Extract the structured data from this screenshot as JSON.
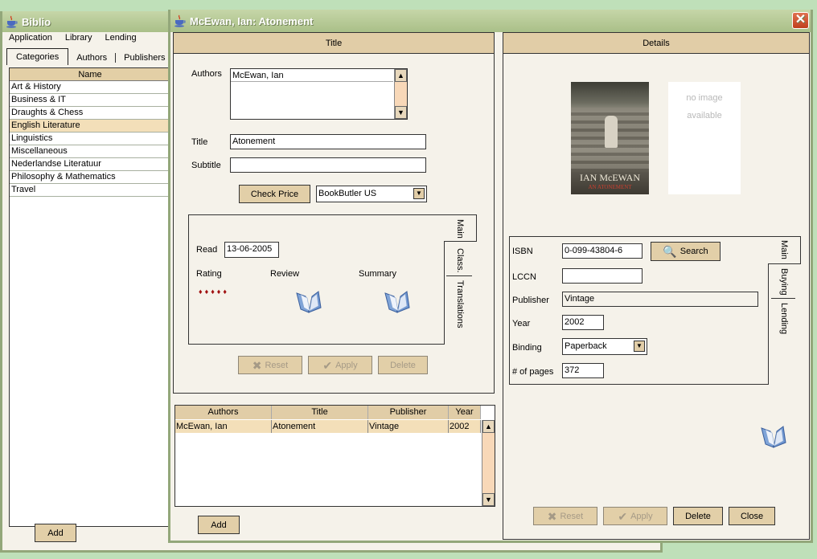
{
  "main_window": {
    "title": "Biblio",
    "menu": [
      "Application",
      "Library",
      "Lending"
    ],
    "tabs": [
      {
        "label": "Categories",
        "active": true
      },
      {
        "label": "Authors",
        "active": false
      },
      {
        "label": "Publishers",
        "active": false
      }
    ],
    "category_list": {
      "header": "Name",
      "items": [
        {
          "label": "Art & History",
          "selected": false
        },
        {
          "label": "Business & IT",
          "selected": false
        },
        {
          "label": "Draughts & Chess",
          "selected": false
        },
        {
          "label": "English Literature",
          "selected": true
        },
        {
          "label": "Linguistics",
          "selected": false
        },
        {
          "label": "Miscellaneous",
          "selected": false
        },
        {
          "label": "Nederlandse Literatuur",
          "selected": false
        },
        {
          "label": "Philosophy & Mathematics",
          "selected": false
        },
        {
          "label": "Travel",
          "selected": false
        }
      ]
    },
    "add_label": "Add"
  },
  "dialog": {
    "title": "McEwan, Ian: Atonement",
    "close_icon": "close-x",
    "title_section": {
      "header": "Title",
      "authors_label": "Authors",
      "authors_values": [
        "McEwan, Ian"
      ],
      "title_label": "Title",
      "title_value": "Atonement",
      "subtitle_label": "Subtitle",
      "subtitle_value": "",
      "check_price_label": "Check Price",
      "price_source": "BookButler US",
      "side_tabs": [
        "Main",
        "Class.",
        "Translations"
      ],
      "read_label": "Read",
      "read_value": "13-06-2005",
      "rating_label": "Rating",
      "rating_value": 5,
      "rating_max": 5,
      "review_label": "Review",
      "summary_label": "Summary",
      "reset_label": "Reset",
      "apply_label": "Apply",
      "delete_label": "Delete"
    },
    "books_table": {
      "columns": [
        "Authors",
        "Title",
        "Publisher",
        "Year"
      ],
      "rows": [
        {
          "authors": "McEwan, Ian",
          "title": "Atonement",
          "publisher": "Vintage",
          "year": "2002"
        }
      ],
      "add_label": "Add"
    },
    "details_section": {
      "header": "Details",
      "cover_text_author": "IAN McEWAN",
      "cover_text_title": "AN ATONEMENT",
      "no_image_line1": "no image",
      "no_image_line2": "available",
      "side_tabs": [
        "Main",
        "Buying",
        "Lending"
      ],
      "isbn_label": "ISBN",
      "isbn_value": "0-099-43804-6",
      "search_label": "Search",
      "lccn_label": "LCCN",
      "lccn_value": "",
      "publisher_label": "Publisher",
      "publisher_value": "Vintage",
      "year_label": "Year",
      "year_value": "2002",
      "binding_label": "Binding",
      "binding_value": "Paperback",
      "pages_label": "# of pages",
      "pages_value": "372",
      "reset_label": "Reset",
      "apply_label": "Apply",
      "delete_label": "Delete",
      "close_label": "Close"
    }
  }
}
